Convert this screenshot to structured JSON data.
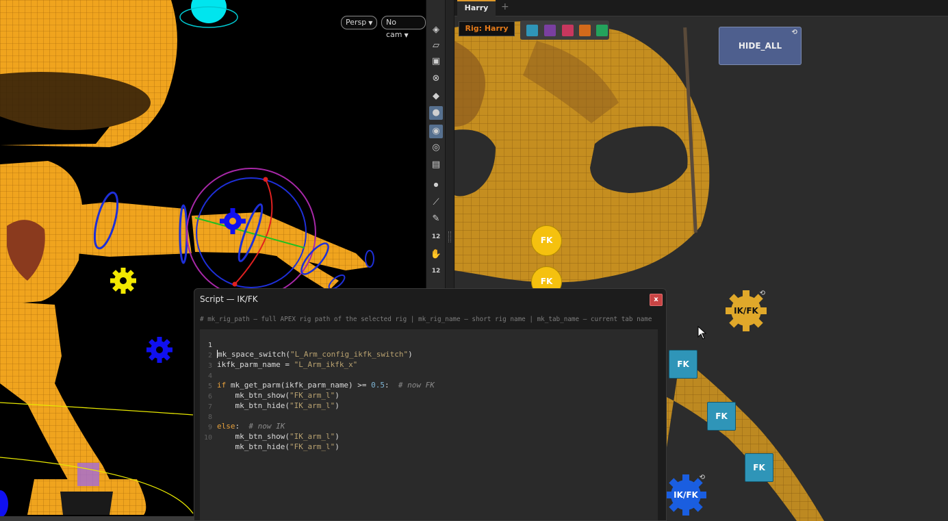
{
  "viewport": {
    "persp_label": "Persp",
    "cam_label": "No cam"
  },
  "toolbar": {
    "icons": [
      "layers-icon",
      "mesh-icon",
      "lock-icon",
      "ghost-icon",
      "light-icon",
      "bulb-icon",
      "camera-icon",
      "eye-icon",
      "render-icon",
      "dot-icon",
      "measure-icon",
      "pin-icon",
      "twelve-icon",
      "hand-icon",
      "twelve-icon"
    ],
    "label_12a": "12",
    "label_12b": "12"
  },
  "tabs": {
    "active": "Harry",
    "add": "+"
  },
  "rig_label": "Rig: Harry",
  "swatch_colors": [
    "#2f95b8",
    "#7a3fa0",
    "#c8375e",
    "#d36a1b",
    "#24a35c"
  ],
  "buttons": {
    "hide_all": "HIDE_ALL",
    "reload_glyph": "⟲",
    "fk_circle_1": "FK",
    "fk_circle_2": "FK",
    "ikfk_gear_top": "IK/FK",
    "fk_square_1": "FK",
    "fk_square_2": "FK",
    "fk_square_3": "FK",
    "ikfk_gear_bottom": "IK/FK"
  },
  "script": {
    "title": "Script — IK/FK",
    "close": "x",
    "hint": "# mk_rig_path — full APEX rig path of the selected rig  |  mk_rig_name — short rig name  |  mk_tab_name — current tab name",
    "line_numbers": [
      "1",
      "2",
      "3",
      "4",
      "5",
      "6",
      "7",
      "8",
      "9",
      "10"
    ],
    "lines": {
      "l1_fn": "mk_space_switch(",
      "l1_arg": "\"L_Arm_config_ikfk_switch\"",
      "l1_end": ")",
      "l2_var": "ikfk_parm_name = ",
      "l2_str": "\"L_Arm_ikfk_x\"",
      "l4_if": "if",
      "l4_mid": " mk_get_parm(ikfk_parm_name) >= ",
      "l4_num": "0.5",
      "l4_colon": ":  ",
      "l4_cmt": "# now FK",
      "l5_fn": "    mk_btn_show(",
      "l5_str": "\"FK_arm_l\"",
      "l5_end": ")",
      "l6_fn": "    mk_btn_hide(",
      "l6_str": "\"IK_arm_l\"",
      "l6_end": ")",
      "l8_else": "else",
      "l8_colon": ":  ",
      "l8_cmt": "# now IK",
      "l9_fn": "    mk_btn_show(",
      "l9_str": "\"IK_arm_l\"",
      "l9_end": ")",
      "l10_fn": "    mk_btn_hide(",
      "l10_str": "\"FK_arm_l\"",
      "l10_end": ")"
    }
  }
}
